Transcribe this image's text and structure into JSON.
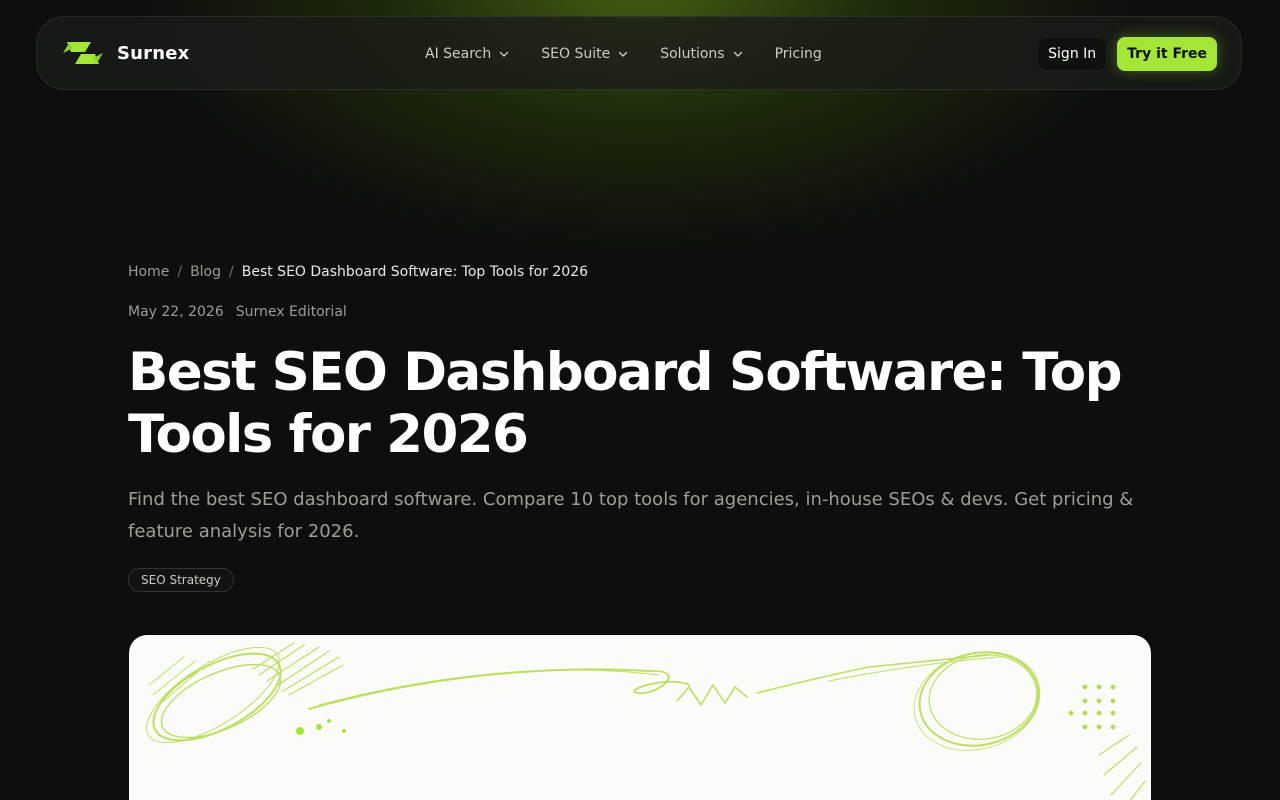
{
  "brand": {
    "name": "Surnex",
    "logo_icon": "surnex-logo-icon",
    "accent": "#a3e635"
  },
  "nav": {
    "items": [
      {
        "label": "AI Search",
        "has_dropdown": true
      },
      {
        "label": "SEO Suite",
        "has_dropdown": true
      },
      {
        "label": "Solutions",
        "has_dropdown": true
      },
      {
        "label": "Pricing",
        "has_dropdown": false
      }
    ],
    "sign_in": "Sign In",
    "cta": "Try it Free"
  },
  "breadcrumb": {
    "home": "Home",
    "blog": "Blog",
    "current": "Best SEO Dashboard Software: Top Tools for 2026",
    "separator": "/"
  },
  "article": {
    "date": "May 22, 2026",
    "author": "Surnex Editorial",
    "title": "Best SEO Dashboard Software: Top Tools for 2026",
    "description": "Find the best SEO dashboard software. Compare 10 top tools for agencies, in-house SEOs & devs. Get pricing & feature analysis for 2026.",
    "tag": "SEO Strategy"
  },
  "colors": {
    "background": "#0d0e0d",
    "accent": "#a3e635",
    "muted_text": "#9b9d99"
  }
}
